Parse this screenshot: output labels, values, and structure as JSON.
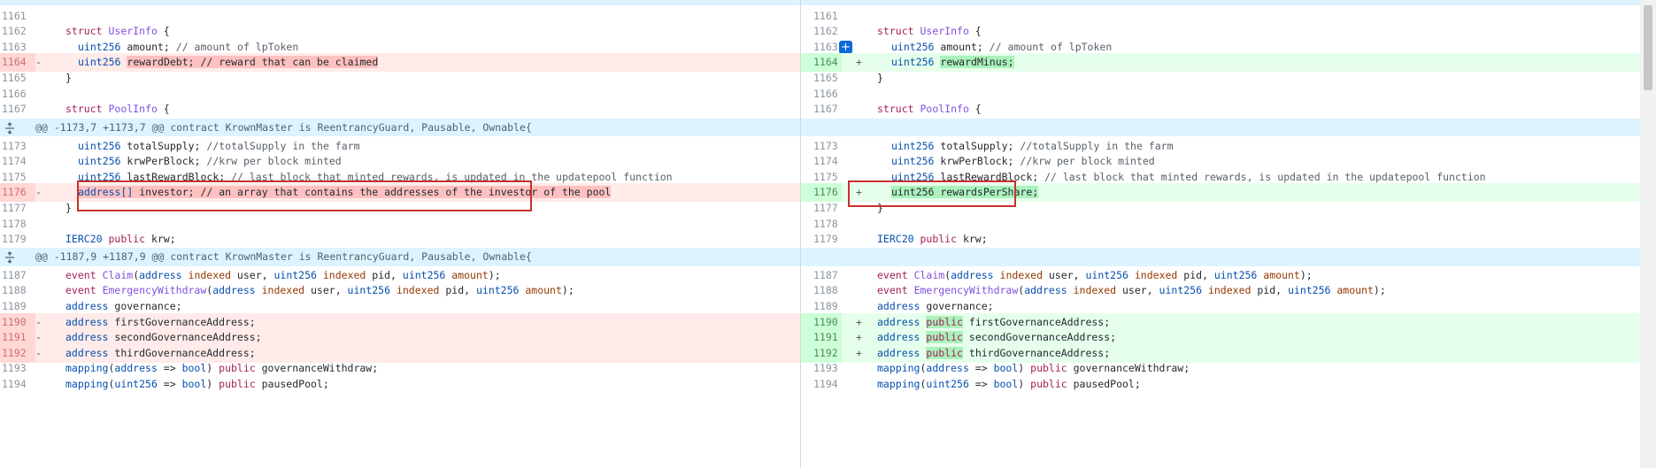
{
  "hunk_header_1": "@@ -1173,7 +1173,7 @@ contract KrownMaster is ReentrancyGuard, Pausable, Ownable{",
  "hunk_header_2": "@@ -1187,9 +1187,9 @@ contract KrownMaster is ReentrancyGuard, Pausable, Ownable{",
  "markers": {
    "del": "-",
    "add": "+"
  },
  "icons": {
    "expand": "unfold-icon",
    "add_comment": "plus-icon"
  },
  "colors": {
    "deletion_bg": "#ffebe9",
    "addition_bg": "#e6ffec",
    "annotation": "#c8312b"
  },
  "left": {
    "ln": [
      "1161",
      "1162",
      "1163",
      "1164",
      "1165",
      "1166",
      "1167",
      "1173",
      "1174",
      "1175",
      "1176",
      "1177",
      "1178",
      "1179",
      "1187",
      "1188",
      "1189",
      "1190",
      "1191",
      "1192",
      "1193",
      "1194"
    ]
  },
  "right": {
    "ln": [
      "1161",
      "1162",
      "1163",
      "1164",
      "1165",
      "1166",
      "1167",
      "1173",
      "1174",
      "1175",
      "1176",
      "1177",
      "1178",
      "1179",
      "1187",
      "1188",
      "1189",
      "1190",
      "1191",
      "1192",
      "1193",
      "1194"
    ]
  },
  "t": {
    "struct": "struct",
    "UserInfo": "UserInfo",
    "PoolInfo": "PoolInfo",
    "brace_open": " {",
    "brace_close": "}",
    "uint256": "uint256",
    "address": "address",
    "address_arr": "address[]",
    "public": "public",
    "IERC20": "IERC20",
    "event": "event",
    "mapping": "mapping",
    "bool": "bool",
    "indexed": "indexed",
    "amount_field": " amount; ",
    "amount_cmt": "// amount of lpToken",
    "rewardDebt": "rewardDebt; // reward that can be claimed",
    "rewardMinus": "rewardMinus;",
    "totalSupply": " totalSupply; ",
    "totalSupply_cmt": "//totalSupply in the farm",
    "krwPerBlock": " krwPerBlock; ",
    "krwPerBlock_cmt": "//krw per block minted",
    "lastRewardBlock": " lastRewardBlock; ",
    "lastRewardBlock_cmt": "// last block that minted rewards, is updated in the updatepool function",
    "investor": " investor; // an array that contains the addresses of the investor of the pool",
    "rewardsPerShare": "uint256 rewardsPerShare;",
    "krw": " krw;",
    "Claim": "Claim",
    "EmergencyWithdraw": "EmergencyWithdraw",
    "paren_open": "(",
    "user": " user, ",
    "pid": " pid, ",
    "amount_arg": " amount",
    "paren_close": ");",
    "governance": " governance;",
    "first": " firstGovernanceAddress;",
    "second": " secondGovernanceAddress;",
    "third": " thirdGovernanceAddress;",
    "first_r": "firstGovernanceAddress;",
    "second_r": "secondGovernanceAddress;",
    "third_r": "thirdGovernanceAddress;",
    "arrow": " => ",
    "close_paren": ") ",
    "governanceWithdraw": " governanceWithdraw;",
    "pausedPool": " pausedPool;"
  }
}
